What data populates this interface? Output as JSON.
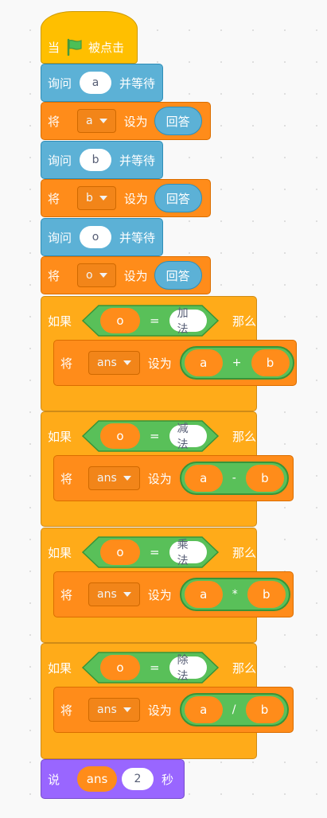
{
  "hat": {
    "when": "当",
    "clicked": "被点击"
  },
  "ask_a": {
    "label": "询问",
    "value": "a",
    "wait": "并等待"
  },
  "set_a": {
    "label": "将",
    "var": "a",
    "to": "设为",
    "answer": "回答"
  },
  "ask_b": {
    "label": "询问",
    "value": "b",
    "wait": "并等待"
  },
  "set_b": {
    "label": "将",
    "var": "b",
    "to": "设为",
    "answer": "回答"
  },
  "ask_o": {
    "label": "询问",
    "value": "o",
    "wait": "并等待"
  },
  "set_o": {
    "label": "将",
    "var": "o",
    "to": "设为",
    "answer": "回答"
  },
  "if_blocks": [
    {
      "if": "如果",
      "var": "o",
      "eq": "=",
      "value": "加法",
      "then": "那么",
      "set": "将",
      "target": "ans",
      "to": "设为",
      "left": "a",
      "op": "+",
      "right": "b"
    },
    {
      "if": "如果",
      "var": "o",
      "eq": "=",
      "value": "减法",
      "then": "那么",
      "set": "将",
      "target": "ans",
      "to": "设为",
      "left": "a",
      "op": "-",
      "right": "b"
    },
    {
      "if": "如果",
      "var": "o",
      "eq": "=",
      "value": "乘法",
      "then": "那么",
      "set": "将",
      "target": "ans",
      "to": "设为",
      "left": "a",
      "op": "*",
      "right": "b"
    },
    {
      "if": "如果",
      "var": "o",
      "eq": "=",
      "value": "除法",
      "then": "那么",
      "set": "将",
      "target": "ans",
      "to": "设为",
      "left": "a",
      "op": "/",
      "right": "b"
    }
  ],
  "say": {
    "label": "说",
    "value": "ans",
    "seconds": "2",
    "unit": "秒"
  },
  "colors": {
    "events": "#FFBF00",
    "sensing": "#5CB1D6",
    "variables": "#FF8C1A",
    "control": "#FFAB19",
    "operators": "#59C059",
    "looks": "#9966FF",
    "flag": "#4CBF56"
  }
}
